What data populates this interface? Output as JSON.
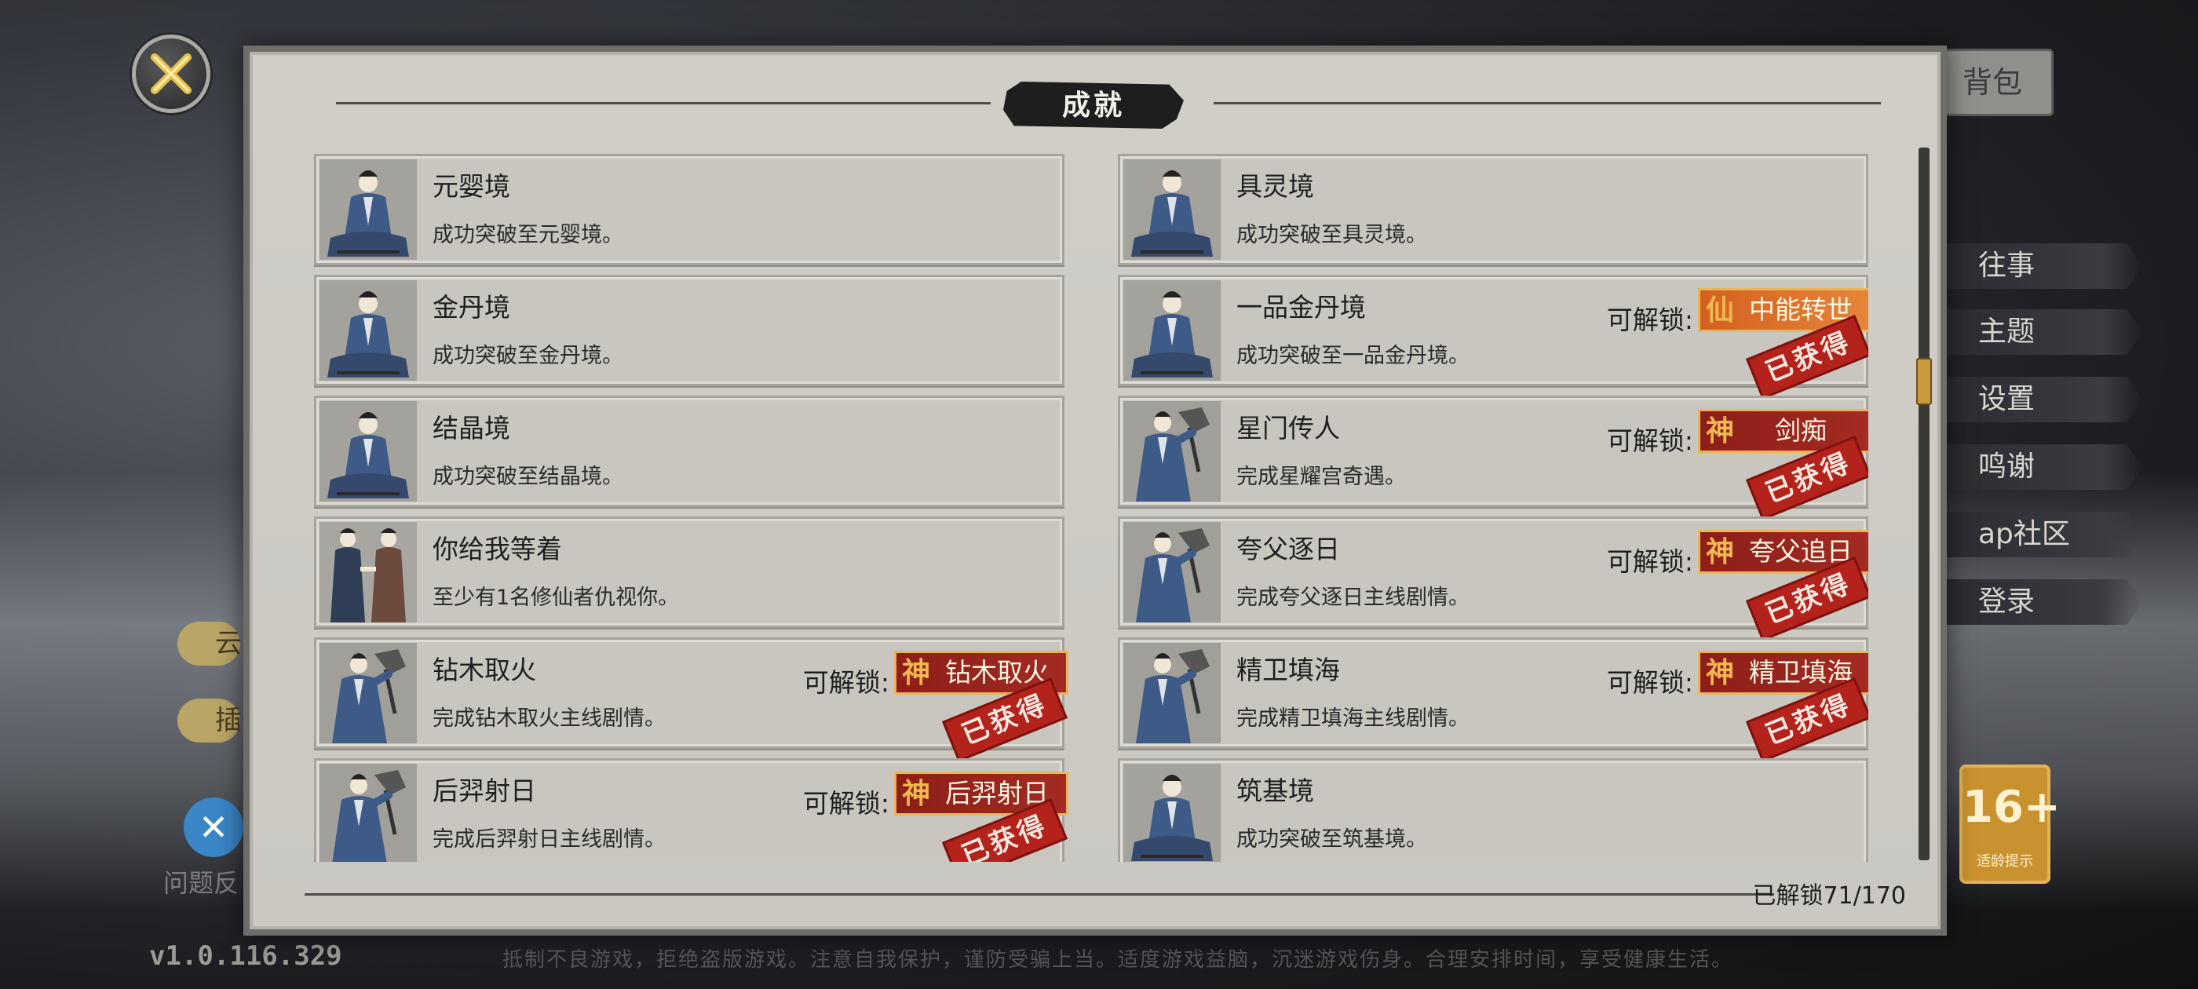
{
  "panel": {
    "title": "成就",
    "unlock_count": "已解锁71/170"
  },
  "labels": {
    "unlock": "可解锁:",
    "obtained_stamp": "已获得"
  },
  "achievements": [
    {
      "title": "元婴境",
      "desc": "成功突破至元婴境。",
      "avatar": "meditating-cultivator"
    },
    {
      "title": "具灵境",
      "desc": "成功突破至具灵境。",
      "avatar": "meditating-cultivator"
    },
    {
      "title": "金丹境",
      "desc": "成功突破至金丹境。",
      "avatar": "meditating-cultivator"
    },
    {
      "title": "一品金丹境",
      "desc": "成功突破至一品金丹境。",
      "avatar": "meditating-cultivator",
      "reward": {
        "rank": "仙",
        "name": "中能转世",
        "obtained": true
      }
    },
    {
      "title": "结晶境",
      "desc": "成功突破至结晶境。",
      "avatar": "meditating-cultivator"
    },
    {
      "title": "星门传人",
      "desc": "完成星耀宫奇遇。",
      "avatar": "standing-cultivator",
      "reward": {
        "rank": "神",
        "name": "剑痴",
        "obtained": true
      }
    },
    {
      "title": "你给我等着",
      "desc": "至少有1名修仙者仇视你。",
      "avatar": "two-cultivators"
    },
    {
      "title": "夸父逐日",
      "desc": "完成夸父逐日主线剧情。",
      "avatar": "standing-cultivator",
      "reward": {
        "rank": "神",
        "name": "夸父追日",
        "obtained": true
      }
    },
    {
      "title": "钻木取火",
      "desc": "完成钻木取火主线剧情。",
      "avatar": "standing-cultivator",
      "reward": {
        "rank": "神",
        "name": "钻木取火",
        "obtained": true
      }
    },
    {
      "title": "精卫填海",
      "desc": "完成精卫填海主线剧情。",
      "avatar": "standing-cultivator",
      "reward": {
        "rank": "神",
        "name": "精卫填海",
        "obtained": true
      }
    },
    {
      "title": "后羿射日",
      "desc": "完成后羿射日主线剧情。",
      "avatar": "standing-cultivator",
      "reward": {
        "rank": "神",
        "name": "后羿射日",
        "obtained": true
      }
    },
    {
      "title": "筑基境",
      "desc": "成功突破至筑基境。",
      "avatar": "meditating-cultivator"
    }
  ],
  "background": {
    "top_right_button": "背包",
    "right_menu": [
      "往事",
      "主题",
      "设置",
      "鸣谢",
      "ap社区",
      "登录"
    ],
    "left_pills": [
      "云",
      "插"
    ],
    "feedback_label": "问题反",
    "age_rating": "16+",
    "age_rating_sub": "适龄提示",
    "version": "v1.0.116.329",
    "notice": "抵制不良游戏，拒绝盗版游戏。注意自我保护，谨防受骗上当。适度游戏益脑，沉迷游戏伤身。合理安排时间，享受健康生活。"
  },
  "colors": {
    "panel_bg": "#cdcbc4",
    "reward_god": "#a32b22",
    "reward_xian": "#e5853a",
    "stamp_red": "#b3231c",
    "scroll_thumb": "#c79a3d"
  }
}
